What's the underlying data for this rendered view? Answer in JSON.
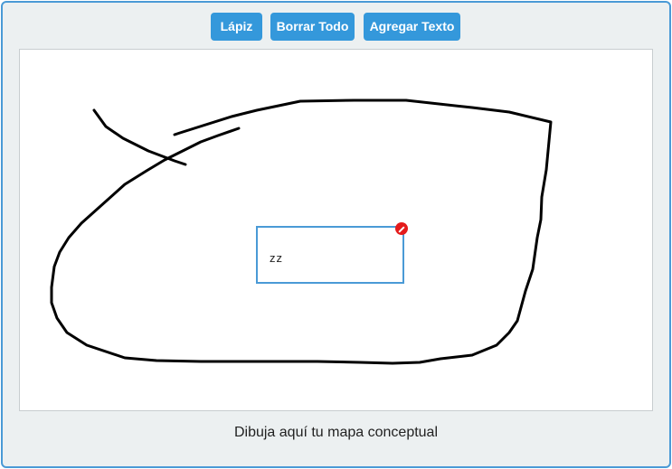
{
  "toolbar": {
    "pencil_label": "Lápiz",
    "clear_label": "Borrar Todo",
    "add_text_label": "Agregar Texto"
  },
  "canvas": {
    "text_box": {
      "value": "zz"
    }
  },
  "caption": "Dibuja aquí tu mapa conceptual",
  "colors": {
    "accent": "#3498db",
    "frame_border": "#4a9ad6",
    "background": "#ecf0f1",
    "stroke": "#000000",
    "delete_handle": "#e41b1b"
  },
  "icons": {
    "delete_handle": "close-icon"
  }
}
